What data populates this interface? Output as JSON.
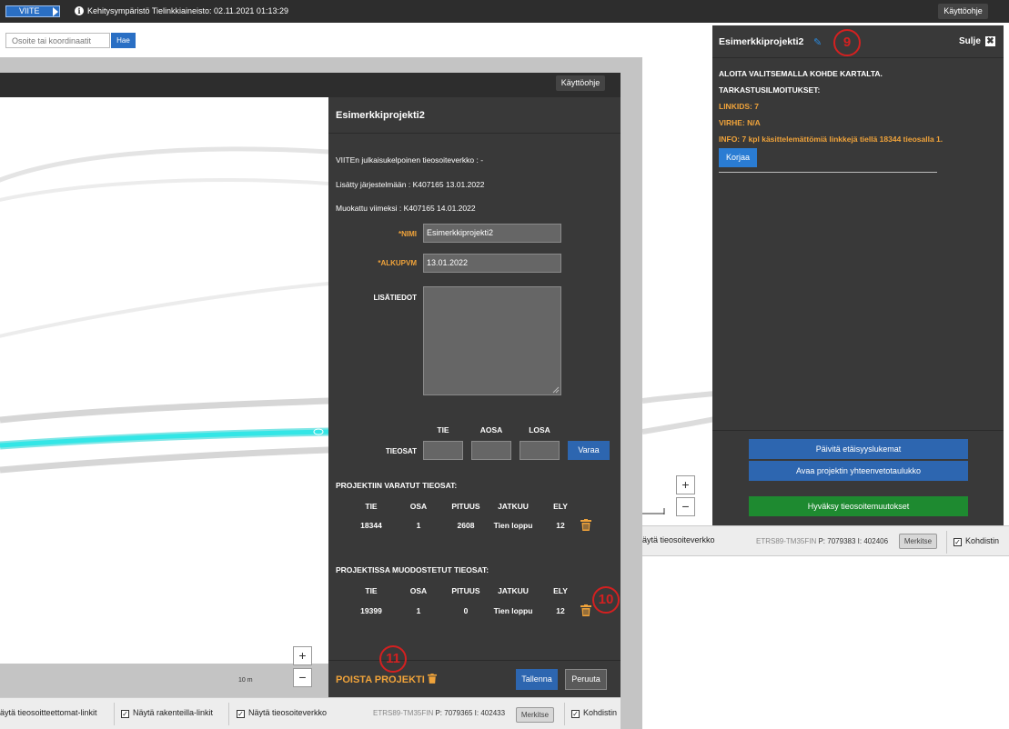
{
  "top_bar": {
    "env_badge": "VIITE",
    "status": "Kehitysympäristö Tielinkkiaineisto: 02.11.2021 01:13:29",
    "help_button": "Käyttöohje"
  },
  "search": {
    "placeholder": "Osoite tai koordinaatit",
    "button": "Hae"
  },
  "right_panel": {
    "title": "Esimerkkiprojekti2",
    "close_label": "Sulje",
    "close_icon": "✖",
    "instruction": "ALOITA VALITSEMALLA KOHDE KARTALTA.",
    "validation_header": "TARKASTUSILMOITUKSET:",
    "linkids": "LINKIDS: 7",
    "virhe": "VIRHE: N/A",
    "info": "INFO: 7 kpl käsittelemättömiä linkkejä tiellä 18344 tieosalla 1.",
    "fix_button": "Korjaa",
    "refresh_button": "Päivitä etäisyyslukemat",
    "summary_button": "Avaa projektin yhteenvetotaulukko",
    "accept_button": "Hyväksy tieosoitemuutokset"
  },
  "callouts": {
    "c9": "9",
    "c10": "10",
    "c11": "11"
  },
  "back_status_bar": {
    "show_network": "äytä tieosoiteverkko",
    "projection": "ETRS89-TM35FIN",
    "p_label": "P:",
    "p_value": "7079383",
    "i_label": "I:",
    "i_value": "402406",
    "mark_button": "Merkitse",
    "crosshair": "Kohdistin"
  },
  "front_window": {
    "help_button": "Käyttöohje",
    "scale": "10 m"
  },
  "form": {
    "title": "Esimerkkiprojekti2",
    "public_network": "VIITEn julkaisukelpoinen tieosoiteverkko : -",
    "added": "Lisätty järjestelmään : K407165 13.01.2022",
    "modified": "Muokattu viimeksi : K407165 14.01.2022",
    "name_label": "*NIMI",
    "name_value": "Esimerkkiprojekti2",
    "start_label": "*ALKUPVM",
    "start_value": "13.01.2022",
    "extra_label": "LISÄTIEDOT",
    "col_tie": "TIE",
    "col_aosa": "AOSA",
    "col_losa": "LOSA",
    "tieosat_label": "TIEOSAT",
    "reserve_button": "Varaa",
    "reserved_header": "PROJEKTIIN VARATUT TIEOSAT:",
    "formed_header": "PROJEKTISSA MUODOSTETUT TIEOSAT:",
    "table_headers": [
      "TIE",
      "OSA",
      "PITUUS",
      "JATKUU",
      "ELY"
    ],
    "reserved_rows": [
      [
        "18344",
        "1",
        "2608",
        "Tien loppu",
        "12"
      ]
    ],
    "formed_rows": [
      [
        "19399",
        "1",
        "0",
        "Tien loppu",
        "12"
      ]
    ],
    "delete_project": "POISTA PROJEKTI",
    "save_button": "Tallenna",
    "cancel_button": "Peruuta"
  },
  "front_status_bar": {
    "no_address_links": "äytä tieosoitteettomat-linkit",
    "under_construction": "Näytä rakenteilla-linkit",
    "show_network": "Näytä tieosoiteverkko",
    "projection": "ETRS89-TM35FIN",
    "p_label": "P:",
    "p_value": "7079365",
    "i_label": "I:",
    "i_value": "402433",
    "mark_button": "Merkitse",
    "crosshair": "Kohdistin"
  },
  "colors": {
    "accent_blue": "#2d66b0",
    "warning_orange": "#f0a33a",
    "accept_green": "#1e8a30",
    "panel_bg": "#393939",
    "callout_red": "#d42020",
    "road_cyan": "#33e6e6"
  }
}
